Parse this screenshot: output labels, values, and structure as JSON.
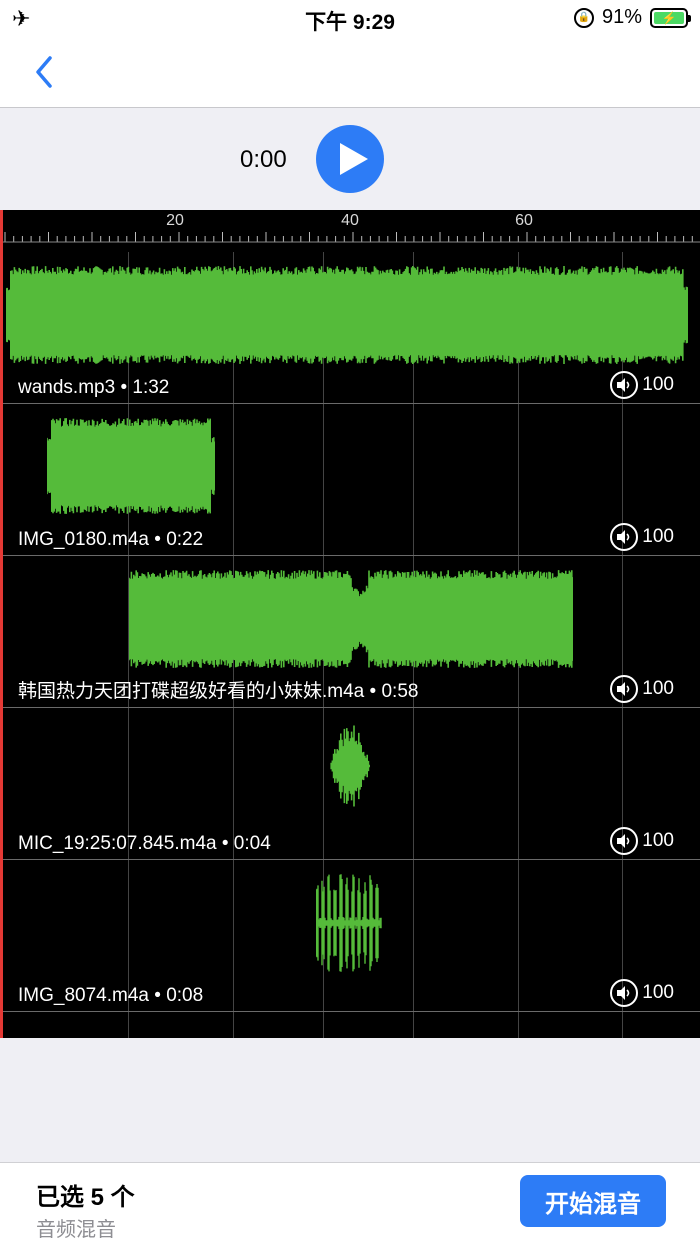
{
  "status_bar": {
    "airplane_glyph": "✈",
    "time": "下午 9:29",
    "battery_percent": "91%",
    "battery_level": 0.91
  },
  "player": {
    "current_time": "0:00"
  },
  "ruler": {
    "labels": [
      "20",
      "40",
      "60"
    ]
  },
  "tracks": [
    {
      "name": "wands.mp3",
      "duration": "1:32",
      "volume": "100"
    },
    {
      "name": "IMG_0180.m4a",
      "duration": "0:22",
      "volume": "100"
    },
    {
      "name": "韩国热力天团打碟超级好看的小妹妹.m4a",
      "duration": "0:58",
      "volume": "100"
    },
    {
      "name": "MIC_19:25:07.845.m4a",
      "duration": "0:04",
      "volume": "100"
    },
    {
      "name": "IMG_8074.m4a",
      "duration": "0:08",
      "volume": "100"
    }
  ],
  "separator": "•",
  "bottom_bar": {
    "selected_label": "已选 5 个",
    "subtitle": "音频混音",
    "mix_button": "开始混音"
  },
  "colors": {
    "accent": "#2d7cf6",
    "waveform": "#55bb3a",
    "playhead": "#e53935"
  }
}
